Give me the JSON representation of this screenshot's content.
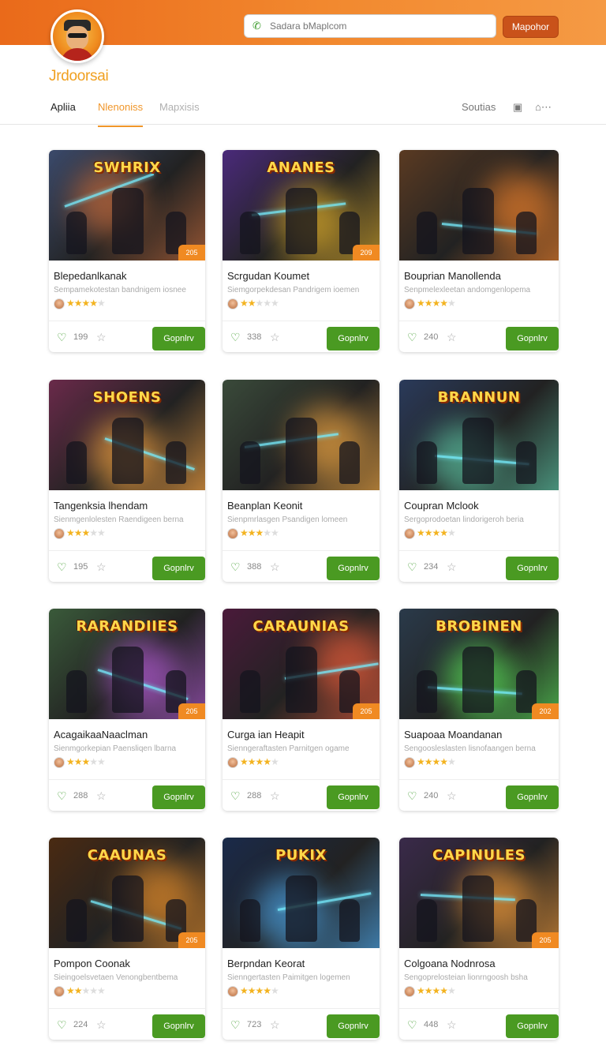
{
  "header": {
    "search_placeholder": "Sadara bMaplcom",
    "top_button": "Mapohor",
    "brand": "Jrdoorsai",
    "colors": {
      "accent": "#f0962a",
      "topbar": "#ea6a1a",
      "primary_button": "#4a9a22"
    }
  },
  "tabs": [
    {
      "label": "Apliia"
    },
    {
      "label": "Nlenoniss"
    },
    {
      "label": "Mapxisis"
    }
  ],
  "right_nav": {
    "label": "Soutias"
  },
  "cards": [
    {
      "name": "Blepedanlkanak",
      "desc": "Sempamekotestan bandnigem iosnee",
      "rating": 4,
      "count": "199",
      "badge": "205",
      "button": "Gopnlrv",
      "art": "SWHRIX",
      "c1": "#3b4a6b",
      "c2": "#c56a3a"
    },
    {
      "name": "Scrgudan Koumet",
      "desc": "Siemgorpekdesan Pandrigem ioemen",
      "rating": 2,
      "count": "338",
      "badge": "209",
      "button": "Gopnlrv",
      "art": "ANANES",
      "c1": "#4a2a7a",
      "c2": "#d8a82a"
    },
    {
      "name": "Bouprian Manollenda",
      "desc": "Senpmelexleetan andomgenlopema",
      "rating": 4,
      "count": "240",
      "badge": "",
      "button": "Gopnlrv",
      "art": "",
      "c1": "#5a3a22",
      "c2": "#e07a2a"
    },
    {
      "name": "Tangenksia lhendam",
      "desc": "Sienmgenlolesten Raendigeen berna",
      "rating": 3,
      "count": "195",
      "badge": "",
      "button": "Gopnlrv",
      "art": "SHOENS",
      "c1": "#6a2a4a",
      "c2": "#f2a040"
    },
    {
      "name": "Beanplan Keonit",
      "desc": "Sienpmrlasgen Psandigen lomeen",
      "rating": 3,
      "count": "388",
      "badge": "",
      "button": "Gopnlrv",
      "art": "",
      "c1": "#3a4a3a",
      "c2": "#e6a040"
    },
    {
      "name": "Coupran Mclook",
      "desc": "Sergoprodoetan lindorigeroh beria",
      "rating": 4,
      "count": "234",
      "badge": "",
      "button": "Gopnlrv",
      "art": "BRANNUN",
      "c1": "#2a3a5a",
      "c2": "#5ac0a0"
    },
    {
      "name": "AcagaikaaNaaclman",
      "desc": "Sienmgorkepian Paensliqen lbarna",
      "rating": 3,
      "count": "288",
      "badge": "205",
      "button": "Gopnlrv",
      "art": "RARANDIIES",
      "c1": "#3a5a3a",
      "c2": "#b05ad0"
    },
    {
      "name": "Curga ian Heapit",
      "desc": "Sienngeraftasten Parnitgen ogame",
      "rating": 4,
      "count": "288",
      "badge": "205",
      "button": "Gopnlrv",
      "art": "CARAUNIAS",
      "c1": "#4a1a3a",
      "c2": "#e05a3a"
    },
    {
      "name": "Suapoaa Moandanan",
      "desc": "Sengoosleslasten lisnofaangen berna",
      "rating": 4,
      "count": "240",
      "badge": "202",
      "button": "Gopnlrv",
      "art": "BROBINEN",
      "c1": "#2a3a4a",
      "c2": "#5ae05a"
    },
    {
      "name": "Pompon Coonak",
      "desc": "Sieingoelsvetaen Venongbentbema",
      "rating": 2,
      "count": "224",
      "badge": "205",
      "button": "Gopnlrv",
      "art": "CAAUNAS",
      "c1": "#4a2a12",
      "c2": "#e08a2a"
    },
    {
      "name": "Berpndan Keorat",
      "desc": "Sienngertasten Paimitgen logemen",
      "rating": 4,
      "count": "723",
      "badge": "",
      "button": "Gopnlrv",
      "art": "PUKIX",
      "c1": "#1a2a4a",
      "c2": "#4aa0e0"
    },
    {
      "name": "Colgoana Nodnrosa",
      "desc": "Sengoprelosteian lionrngoosh bsha",
      "rating": 4,
      "count": "448",
      "badge": "205",
      "button": "Gopnlrv",
      "art": "CAPINULES",
      "c1": "#3a2a4a",
      "c2": "#f09a3a"
    }
  ]
}
